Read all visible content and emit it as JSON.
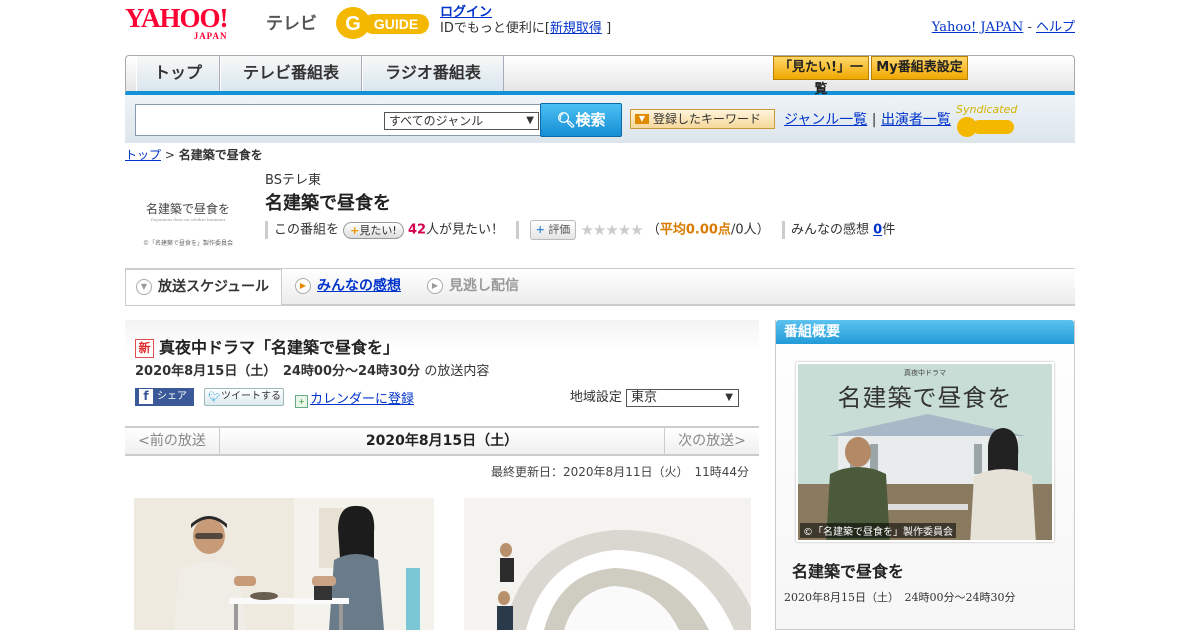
{
  "header": {
    "yahoo_logo": "YAHOO!",
    "yahoo_logo_sub": "JAPAN",
    "tv_label": "テレビ",
    "gguide_logo": "GUIDE",
    "login_link": "ログイン",
    "login_prompt": "IDでもっと便利に[",
    "register_link": "新規取得",
    "bracket_close": " ]",
    "yahoo_japan_link": "Yahoo! JAPAN",
    "dash": " - ",
    "help_link": "ヘルプ"
  },
  "nav": {
    "tabs": [
      "トップ",
      "テレビ番組表",
      "ラジオ番組表"
    ],
    "mitai_list": "「見たい!」一覧",
    "my_schedule": "My番組表設定"
  },
  "search": {
    "genre_selected": "すべてのジャンル",
    "button_label": "検索",
    "keyword_button": "登録したキーワード",
    "genre_list_link": "ジャンル一覧",
    "divider": " | ",
    "performer_link": "出演者一覧",
    "syndicated": "Syndicated"
  },
  "breadcrumb": {
    "top": "トップ",
    "sep": " > ",
    "current": "名建築で昼食を"
  },
  "program": {
    "thumb_title": "名建築で昼食を",
    "thumb_sub": "Dejeunons dans un celebre batiment",
    "thumb_credit": "©「名建築で昼食を」製作委員会",
    "channel": "BSテレ東",
    "title": "名建築で昼食を",
    "mitai_prefix": "この番組を",
    "mitai_button": "見たい!",
    "mitai_count": "42",
    "mitai_suffix": "人が見たい！",
    "hyoka_button": "評価",
    "stars": "★★★★★",
    "avg_open": "（",
    "avg_label": "平均0.00点",
    "avg_people": "/0人）",
    "kanso_label": "みんなの感想",
    "kanso_count": "0",
    "kanso_unit": "件"
  },
  "sub_tabs": {
    "schedule": "放送スケジュール",
    "kanso": "みんなの感想",
    "minogashi": "見逃し配信"
  },
  "episode": {
    "new_badge": "新",
    "title": "真夜中ドラマ「名建築で昼食を」",
    "datetime": "2020年8月15日（土）　24時00分～24時30分",
    "datetime_suffix": "の放送内容",
    "fb_share": "シェア",
    "tweet": "ツイートする",
    "calendar_link": "カレンダーに登録",
    "region_label": "地域設定",
    "region_value": "東京"
  },
  "day_nav": {
    "prev": "<前の放送",
    "current": "2020年8月15日（土）",
    "next": "次の放送>"
  },
  "updated": "最終更新日：2020年8月11日（火）　11時44分",
  "sidebar": {
    "header": "番組概要",
    "poster_kicker": "真夜中ドラマ",
    "poster_title": "名建築で昼食を",
    "poster_credit": "©「名建築で昼食を」製作委員会",
    "title": "名建築で昼食を",
    "time": "2020年8月15日（土）　24時00分～24時30分"
  },
  "colors": {
    "accent_blue": "#1591d7",
    "link": "#0033cc",
    "yahoo_red": "#ff0033",
    "mitai_count": "#d4004c"
  }
}
